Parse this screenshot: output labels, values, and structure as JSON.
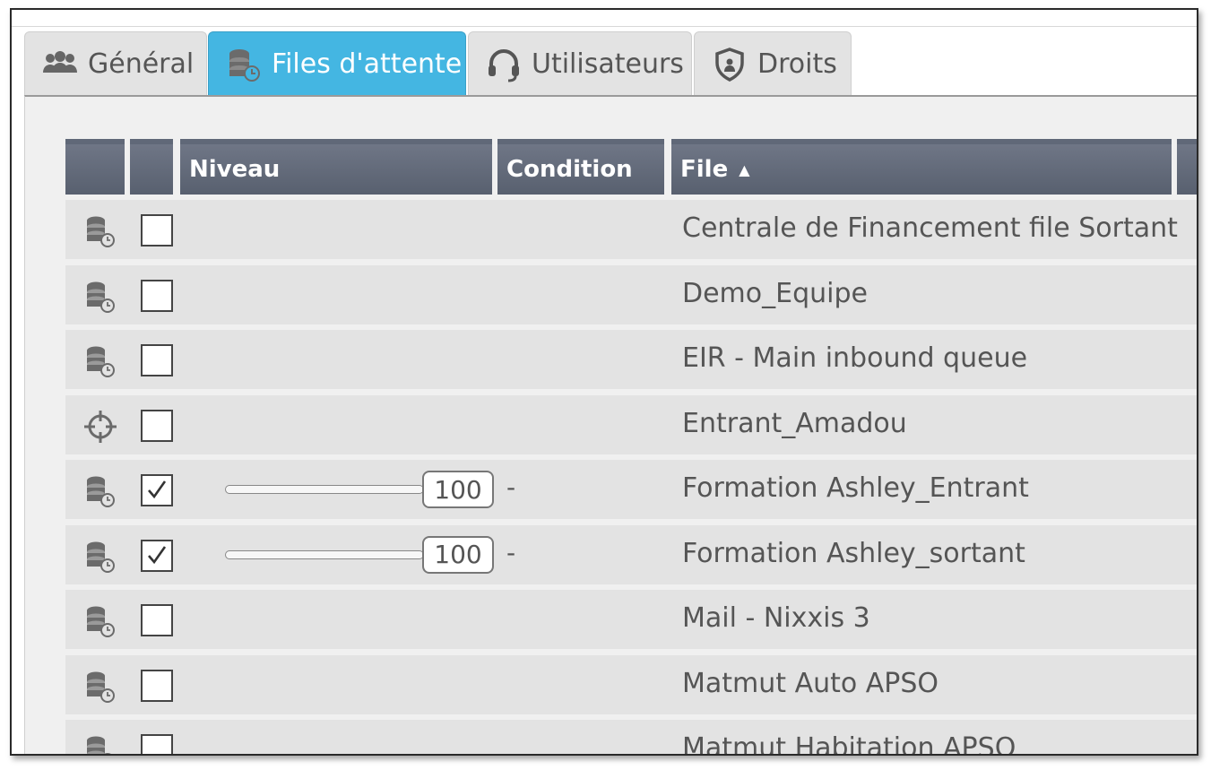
{
  "tabs": [
    {
      "label": "Général",
      "icon": "users-icon",
      "active": false
    },
    {
      "label": "Files d'attente",
      "icon": "queue-icon",
      "active": true
    },
    {
      "label": "Utilisateurs",
      "icon": "headset-icon",
      "active": false
    },
    {
      "label": "Droits",
      "icon": "shield-icon",
      "active": false
    }
  ],
  "table": {
    "columns": [
      "",
      "",
      "Niveau",
      "Condition",
      "File"
    ],
    "sort_column": "File",
    "rows": [
      {
        "icon": "queue-icon",
        "checked": false,
        "file": "Centrale de Financement file Sortant"
      },
      {
        "icon": "queue-icon",
        "checked": false,
        "file": "Demo_Equipe"
      },
      {
        "icon": "queue-icon",
        "checked": false,
        "file": "EIR - Main inbound queue"
      },
      {
        "icon": "crosshair-icon",
        "checked": false,
        "file": "Entrant_Amadou"
      },
      {
        "icon": "queue-icon",
        "checked": true,
        "level": "100",
        "condition": "-",
        "file": "Formation Ashley_Entrant"
      },
      {
        "icon": "queue-icon",
        "checked": true,
        "level": "100",
        "condition": "-",
        "file": "Formation Ashley_sortant"
      },
      {
        "icon": "queue-icon",
        "checked": false,
        "file": "Mail - Nixxis 3"
      },
      {
        "icon": "queue-icon",
        "checked": false,
        "file": "Matmut Auto APSO"
      },
      {
        "icon": "queue-icon",
        "checked": false,
        "file": "Matmut Habitation APSO"
      }
    ]
  },
  "colors": {
    "active_tab": "#44b6e2",
    "header": "#5f6676",
    "row": "#e3e3e3"
  }
}
